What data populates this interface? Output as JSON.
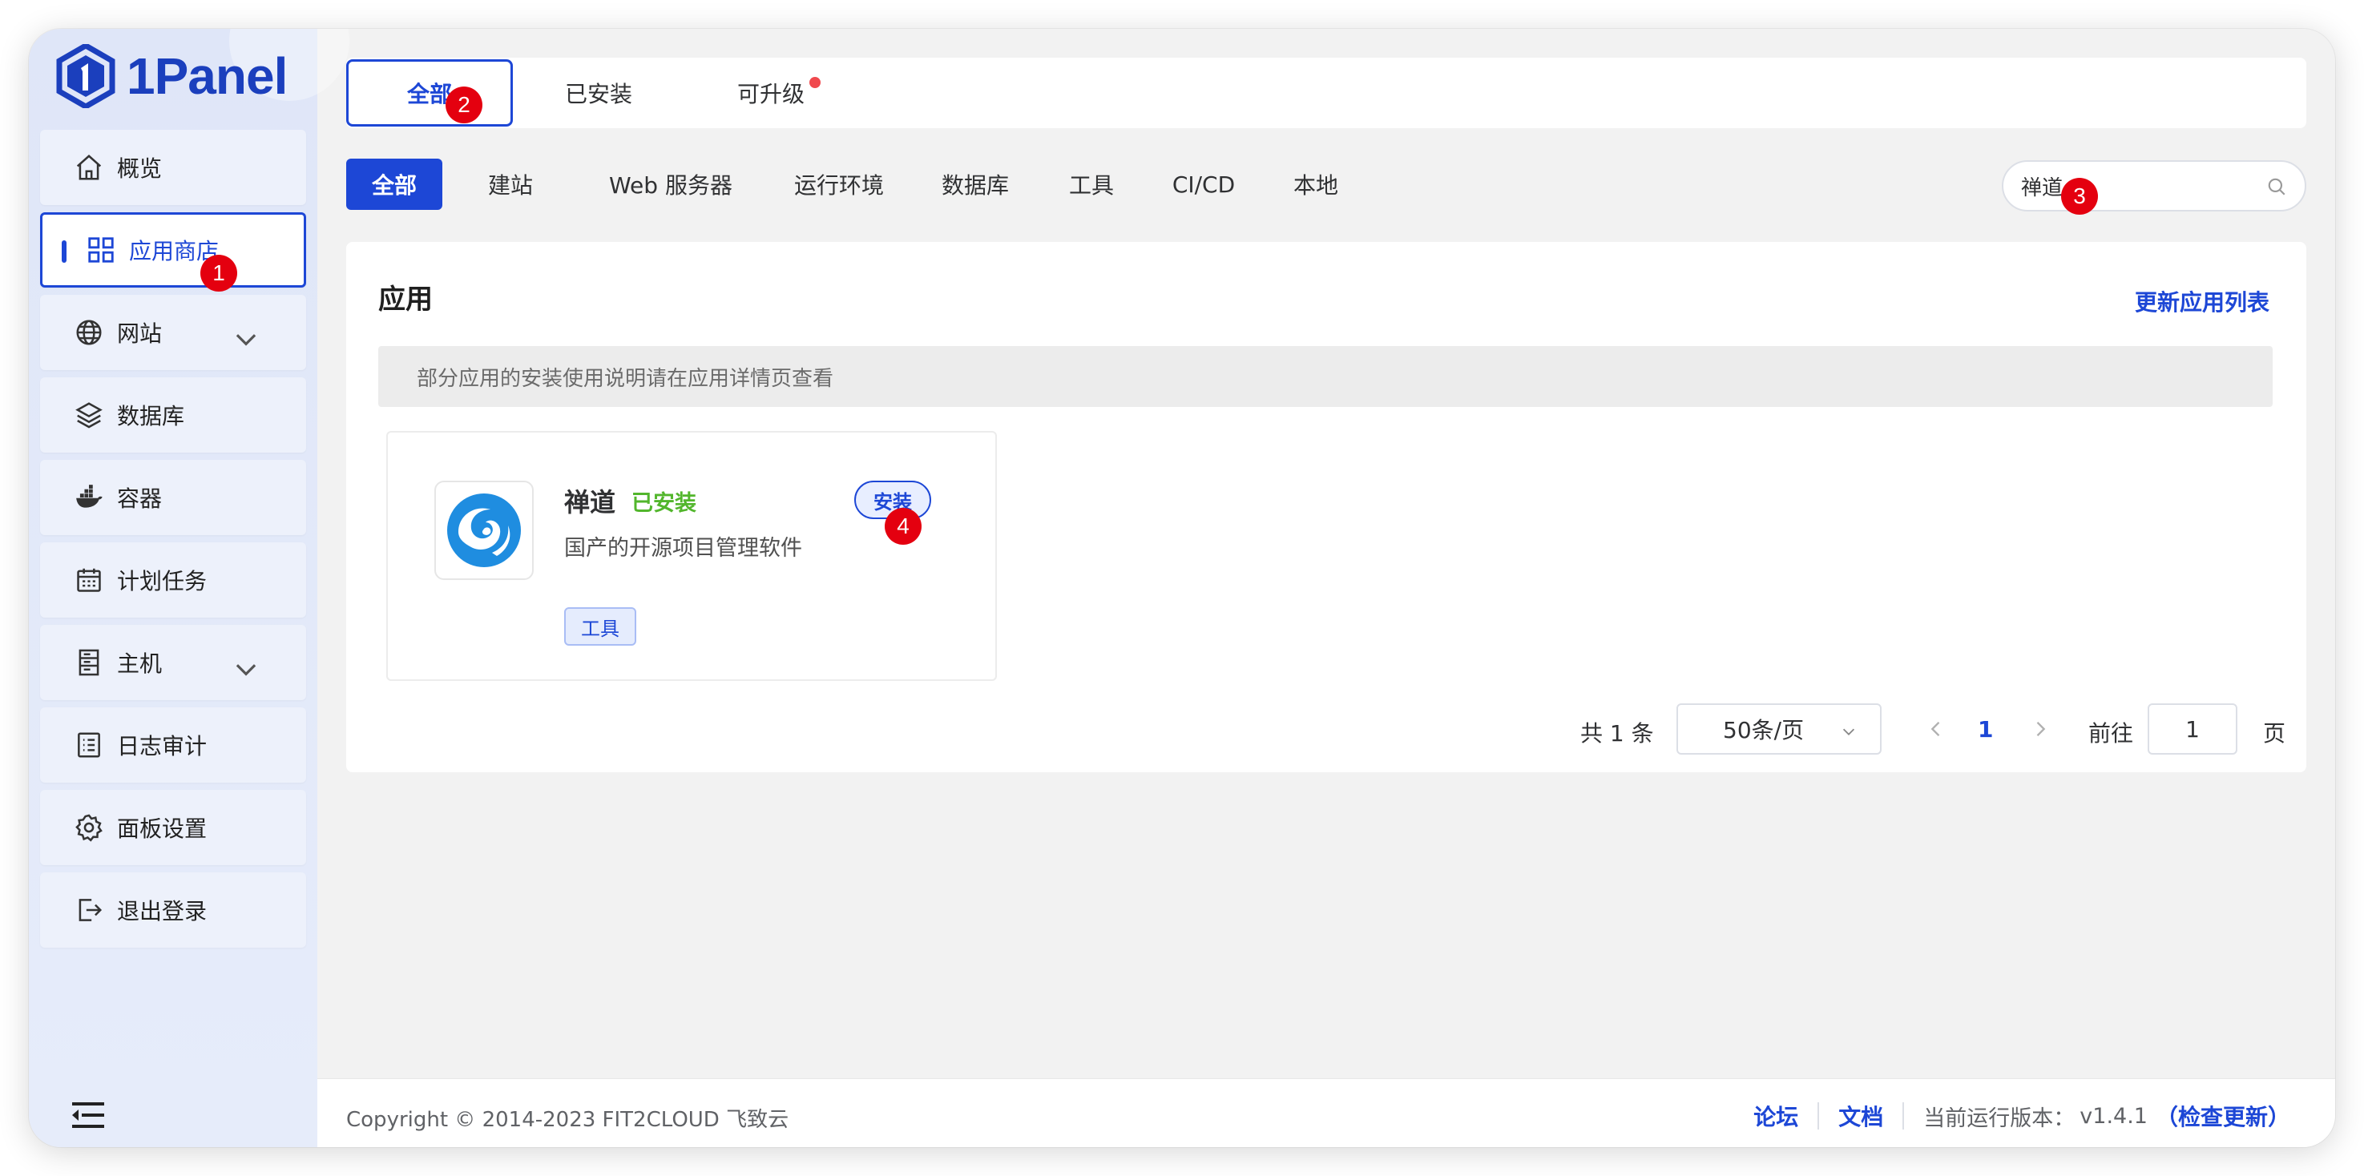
{
  "app": {
    "logo_text": "1Panel"
  },
  "sidebar": {
    "items": [
      {
        "label": "概览",
        "icon": "home-icon"
      },
      {
        "label": "应用商店",
        "icon": "grid-icon",
        "active": true
      },
      {
        "label": "网站",
        "icon": "globe-icon",
        "expandable": true
      },
      {
        "label": "数据库",
        "icon": "layers-icon"
      },
      {
        "label": "容器",
        "icon": "docker-icon"
      },
      {
        "label": "计划任务",
        "icon": "calendar-icon"
      },
      {
        "label": "主机",
        "icon": "server-icon",
        "expandable": true
      },
      {
        "label": "日志审计",
        "icon": "log-icon"
      },
      {
        "label": "面板设置",
        "icon": "gear-icon"
      },
      {
        "label": "退出登录",
        "icon": "logout-icon"
      }
    ]
  },
  "top_tabs": [
    {
      "label": "全部",
      "active": true
    },
    {
      "label": "已安装"
    },
    {
      "label": "可升级",
      "has_dot": true
    }
  ],
  "categories": [
    "全部",
    "建站",
    "Web 服务器",
    "运行环境",
    "数据库",
    "工具",
    "CI/CD",
    "本地"
  ],
  "search": {
    "value": "禅道"
  },
  "content": {
    "title": "应用",
    "refresh_link": "更新应用列表",
    "notice": "部分应用的安装使用说明请在应用详情页查看"
  },
  "app_card": {
    "name": "禅道",
    "status": "已安装",
    "install_label": "安装",
    "description": "国产的开源项目管理软件",
    "tag": "工具"
  },
  "pagination": {
    "total": "共 1 条",
    "page_size": "50条/页",
    "current_page": "1",
    "goto_label": "前往",
    "goto_value": "1",
    "page_unit": "页"
  },
  "footer": {
    "copyright": "Copyright © 2014-2023 FIT2CLOUD 飞致云",
    "forum": "论坛",
    "docs": "文档",
    "version_label": "当前运行版本：",
    "version": "v1.4.1",
    "check_update": "（检查更新）"
  },
  "markers": [
    "1",
    "2",
    "3",
    "4"
  ],
  "colors": {
    "primary": "#1d47d6",
    "success": "#52b62c",
    "marker": "#e4000f"
  }
}
